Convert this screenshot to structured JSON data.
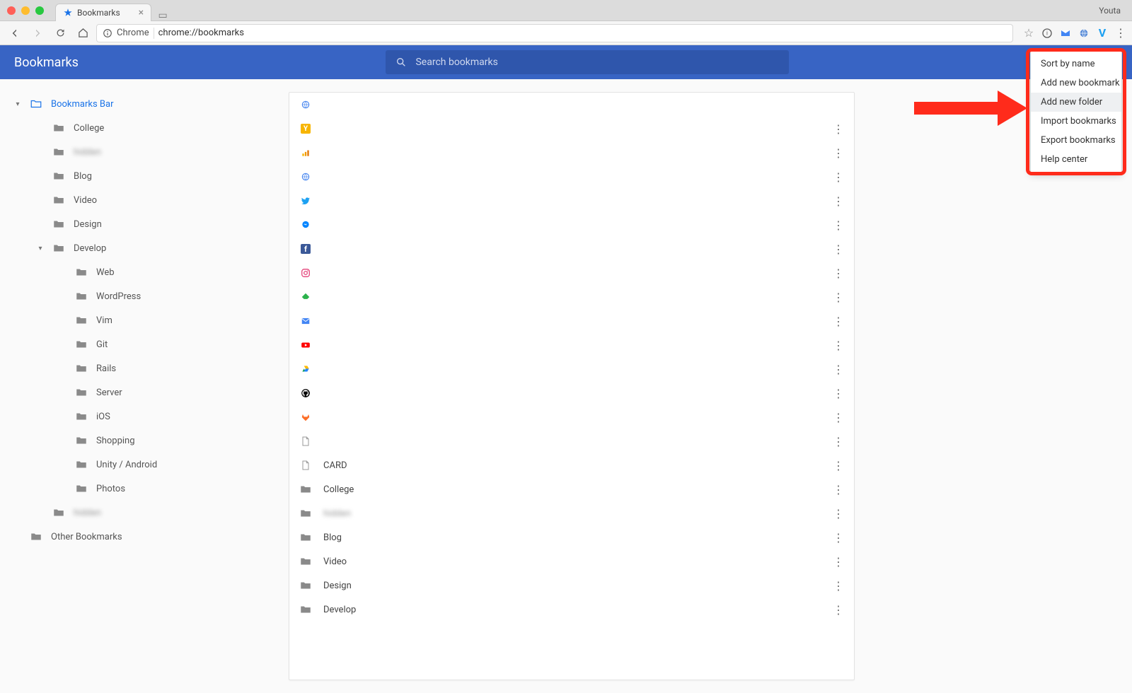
{
  "window": {
    "profile": "Youta"
  },
  "tab": {
    "title": "Bookmarks"
  },
  "toolbar": {
    "chrome_label": "Chrome",
    "url": "chrome://bookmarks"
  },
  "header": {
    "title": "Bookmarks",
    "search_placeholder": "Search bookmarks"
  },
  "sidebar": {
    "root": {
      "label": "Bookmarks Bar"
    },
    "folders": [
      {
        "label": "College"
      },
      {
        "label": "hidden",
        "blur": true
      },
      {
        "label": "Blog"
      },
      {
        "label": "Video"
      },
      {
        "label": "Design"
      },
      {
        "label": "Develop",
        "expanded": true
      }
    ],
    "develop_children": [
      {
        "label": "Web"
      },
      {
        "label": "WordPress"
      },
      {
        "label": "Vim"
      },
      {
        "label": "Git"
      },
      {
        "label": "Rails"
      },
      {
        "label": "Server"
      },
      {
        "label": "iOS"
      },
      {
        "label": "Shopping"
      },
      {
        "label": "Unity / Android"
      },
      {
        "label": "Photos"
      }
    ],
    "after": {
      "label": "hidden",
      "blur": true
    },
    "other": {
      "label": "Other Bookmarks"
    }
  },
  "list": {
    "items": [
      {
        "label": "",
        "icon": "globe",
        "color": "#4f8bf0"
      },
      {
        "label": "",
        "icon": "y",
        "color": "#f7b500"
      },
      {
        "label": "",
        "icon": "analytics",
        "color": "#f29900"
      },
      {
        "label": "",
        "icon": "globe",
        "color": "#4f8bf0"
      },
      {
        "label": "",
        "icon": "twitter",
        "color": "#1da1f2"
      },
      {
        "label": "",
        "icon": "messenger",
        "color": "#0084ff"
      },
      {
        "label": "",
        "icon": "facebook",
        "color": "#3b5998"
      },
      {
        "label": "",
        "icon": "instagram",
        "color": "#e1306c"
      },
      {
        "label": "",
        "icon": "feedly",
        "color": "#2bb24c"
      },
      {
        "label": "",
        "icon": "inbox",
        "color": "#4285f4"
      },
      {
        "label": "",
        "icon": "youtube",
        "color": "#ff0000"
      },
      {
        "label": "",
        "icon": "drive",
        "color": "#0f9d58"
      },
      {
        "label": "",
        "icon": "github",
        "color": "#000000"
      },
      {
        "label": "",
        "icon": "gitlab",
        "color": "#fc6d26"
      },
      {
        "label": "",
        "icon": "page",
        "color": "#888888"
      },
      {
        "label": "CARD",
        "icon": "page",
        "color": "#888888"
      },
      {
        "label": "College",
        "icon": "folder",
        "color": "#8a8a8a"
      },
      {
        "label": "hidden",
        "icon": "folder",
        "color": "#8a8a8a",
        "blur": true
      },
      {
        "label": "Blog",
        "icon": "folder",
        "color": "#8a8a8a"
      },
      {
        "label": "Video",
        "icon": "folder",
        "color": "#8a8a8a"
      },
      {
        "label": "Design",
        "icon": "folder",
        "color": "#8a8a8a"
      },
      {
        "label": "Develop",
        "icon": "folder",
        "color": "#8a8a8a"
      }
    ]
  },
  "menu": {
    "items": [
      {
        "label": "Sort by name"
      },
      {
        "label": "Add new bookmark"
      },
      {
        "label": "Add new folder",
        "hover": true
      },
      {
        "label": "Import bookmarks"
      },
      {
        "label": "Export bookmarks"
      },
      {
        "label": "Help center"
      }
    ]
  }
}
